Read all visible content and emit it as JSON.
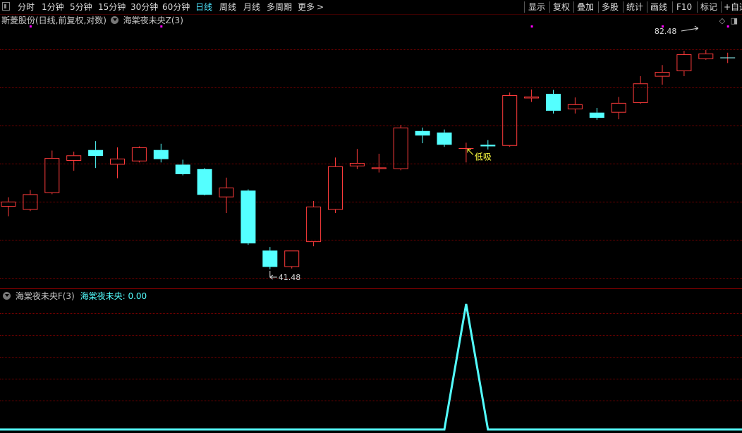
{
  "toolbar": {
    "periods": [
      "分时",
      "1分钟",
      "5分钟",
      "15分钟",
      "30分钟",
      "60分钟",
      "日线",
      "周线",
      "月线",
      "多周期",
      "更多"
    ],
    "active_period": "日线",
    "more_arrow": ">",
    "right_buttons": [
      "显示",
      "复权",
      "叠加",
      "多股",
      "统计",
      "画线",
      "F10",
      "标记",
      "+自选"
    ]
  },
  "main_chart": {
    "stock_title": "斯菱股份(日线,前复权,对数)",
    "indicator_name": "海棠夜未央Z(3)",
    "max_label": "82.48",
    "min_label": "41.48",
    "buy_signal": "低吸",
    "colors": {
      "up": "#ff3b3b",
      "down": "#54ffff",
      "signal_text": "#ffff40",
      "marker": "#ff00ff"
    }
  },
  "sub_chart": {
    "indicator_name": "海棠夜未央F(3)",
    "series_label": "海棠夜未央:",
    "series_value": "0.00",
    "colors": {
      "line": "#54ffff"
    }
  },
  "chart_data": [
    {
      "type": "candlestick",
      "candles": [
        {
          "o": 50.5,
          "h": 52.0,
          "l": 49.0,
          "c": 51.3
        },
        {
          "o": 50.0,
          "h": 53.2,
          "l": 49.8,
          "c": 52.5
        },
        {
          "o": 52.7,
          "h": 60.2,
          "l": 52.5,
          "c": 58.8
        },
        {
          "o": 58.3,
          "h": 60.0,
          "l": 56.5,
          "c": 59.3
        },
        {
          "o": 60.3,
          "h": 62.0,
          "l": 57.0,
          "c": 59.2
        },
        {
          "o": 57.6,
          "h": 60.8,
          "l": 55.2,
          "c": 58.7
        },
        {
          "o": 58.2,
          "h": 61.0,
          "l": 58.0,
          "c": 60.8
        },
        {
          "o": 60.3,
          "h": 61.5,
          "l": 58.0,
          "c": 58.6
        },
        {
          "o": 57.6,
          "h": 58.5,
          "l": 55.7,
          "c": 55.9
        },
        {
          "o": 56.8,
          "h": 57.0,
          "l": 52.3,
          "c": 52.4
        },
        {
          "o": 52.0,
          "h": 55.3,
          "l": 49.5,
          "c": 53.6
        },
        {
          "o": 53.1,
          "h": 53.3,
          "l": 44.8,
          "c": 45.0
        },
        {
          "o": 44.0,
          "h": 44.5,
          "l": 41.5,
          "c": 41.8
        },
        {
          "o": 41.8,
          "h": 44.0,
          "l": 41.6,
          "c": 44.0
        },
        {
          "o": 45.2,
          "h": 51.4,
          "l": 44.6,
          "c": 50.5
        },
        {
          "o": 50.0,
          "h": 58.9,
          "l": 49.5,
          "c": 57.3
        },
        {
          "o": 57.3,
          "h": 60.5,
          "l": 56.8,
          "c": 57.9
        },
        {
          "o": 56.8,
          "h": 59.6,
          "l": 56.2,
          "c": 57.1
        },
        {
          "o": 56.8,
          "h": 65.2,
          "l": 56.6,
          "c": 64.7
        },
        {
          "o": 64.0,
          "h": 64.7,
          "l": 61.6,
          "c": 63.1
        },
        {
          "o": 63.7,
          "h": 64.3,
          "l": 60.9,
          "c": 61.3
        },
        {
          "o": 60.6,
          "h": 61.7,
          "l": 58.0,
          "c": 60.6
        },
        {
          "o": 61.3,
          "h": 62.2,
          "l": 60.4,
          "c": 61.0
        },
        {
          "o": 61.1,
          "h": 72.2,
          "l": 60.9,
          "c": 71.6
        },
        {
          "o": 70.9,
          "h": 72.9,
          "l": 70.1,
          "c": 71.3
        },
        {
          "o": 71.9,
          "h": 72.8,
          "l": 67.6,
          "c": 68.2
        },
        {
          "o": 68.5,
          "h": 71.1,
          "l": 67.6,
          "c": 69.6
        },
        {
          "o": 67.8,
          "h": 68.8,
          "l": 66.3,
          "c": 66.7
        },
        {
          "o": 67.8,
          "h": 71.2,
          "l": 66.4,
          "c": 69.9
        },
        {
          "o": 69.9,
          "h": 76.0,
          "l": 69.7,
          "c": 74.3
        },
        {
          "o": 75.9,
          "h": 78.7,
          "l": 74.0,
          "c": 77.0
        },
        {
          "o": 77.2,
          "h": 82.3,
          "l": 76.0,
          "c": 81.4
        },
        {
          "o": 80.2,
          "h": 82.5,
          "l": 80.0,
          "c": 81.6
        },
        {
          "o": 80.5,
          "h": 81.8,
          "l": 79.2,
          "c": 80.5
        }
      ]
    },
    {
      "type": "line",
      "x": [
        0,
        1,
        2,
        3,
        4,
        5,
        6,
        7,
        8,
        9,
        10,
        11,
        12,
        13,
        14,
        15,
        16,
        17,
        18,
        19,
        20,
        21,
        22,
        23,
        24,
        25,
        26,
        27,
        28,
        29,
        30,
        31,
        32,
        33
      ],
      "values": [
        0,
        0,
        0,
        0,
        0,
        0,
        0,
        0,
        0,
        0,
        0,
        0,
        0,
        0,
        0,
        0,
        0,
        0,
        0,
        0,
        0,
        1,
        0,
        0,
        0,
        0,
        0,
        0,
        0,
        0,
        0,
        0,
        0,
        0
      ],
      "series": [
        {
          "name": "海棠夜未央"
        }
      ]
    }
  ]
}
